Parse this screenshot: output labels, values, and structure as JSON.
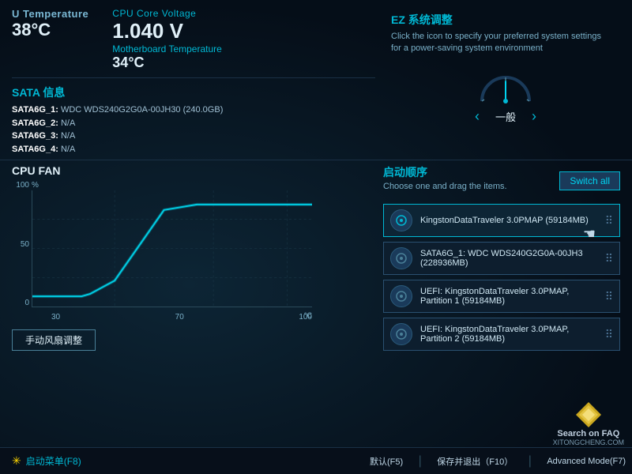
{
  "header": {
    "cpu_temp_label": "U Temperature",
    "cpu_temp_value": "38°C",
    "cpu_voltage_label": "CPU Core Voltage",
    "cpu_voltage_value": "1.040 V",
    "mb_temp_label": "Motherboard Temperature",
    "mb_temp_value": "34°C"
  },
  "sata": {
    "title": "SATA 信息",
    "items": [
      {
        "key": "SATA6G_1:",
        "value": "WDC WDS240G2G0A-00JH30 (240.0GB)"
      },
      {
        "key": "SATA6G_2:",
        "value": "N/A"
      },
      {
        "key": "SATA6G_3:",
        "value": "N/A"
      },
      {
        "key": "SATA6G_4:",
        "value": "N/A"
      }
    ]
  },
  "ez": {
    "title": "EZ 系统调整",
    "desc": "Click the icon to specify your preferred system settings for a power-saving system environment",
    "mode": "一般"
  },
  "fan": {
    "title": "CPU FAN",
    "percent_label": "%",
    "y_labels": [
      "100",
      "50",
      "0"
    ],
    "x_labels": [
      "30",
      "70",
      "100"
    ],
    "temp_unit": "°C",
    "button_label": "手动风扇调整"
  },
  "boot": {
    "title": "启动顺序",
    "subtitle": "Choose one and drag the items.",
    "switch_all_label": "Switch all",
    "items": [
      {
        "name": "KingstonDataTraveler 3.0PMAP (59184MB)",
        "active": true
      },
      {
        "name": "SATA6G_1: WDC WDS240G2G0A-00JH3 (228936MB)",
        "active": false
      },
      {
        "name": "UEFI: KingstonDataTraveler 3.0PMAP, Partition 1 (59184MB)",
        "active": false
      },
      {
        "name": "UEFI: KingstonDataTraveler 3.0PMAP, Partition 2 (59184MB)",
        "active": false
      }
    ],
    "menu_label": "启动菜单(F8)"
  },
  "bottom": {
    "default_btn": "默认(F5)",
    "save_btn": "保存并退出（F10）",
    "advanced_btn": "Advanced Mode(F7)"
  },
  "watermark": {
    "search_label": "Search on FAQ",
    "site": "XITONGCHENG.COM"
  }
}
